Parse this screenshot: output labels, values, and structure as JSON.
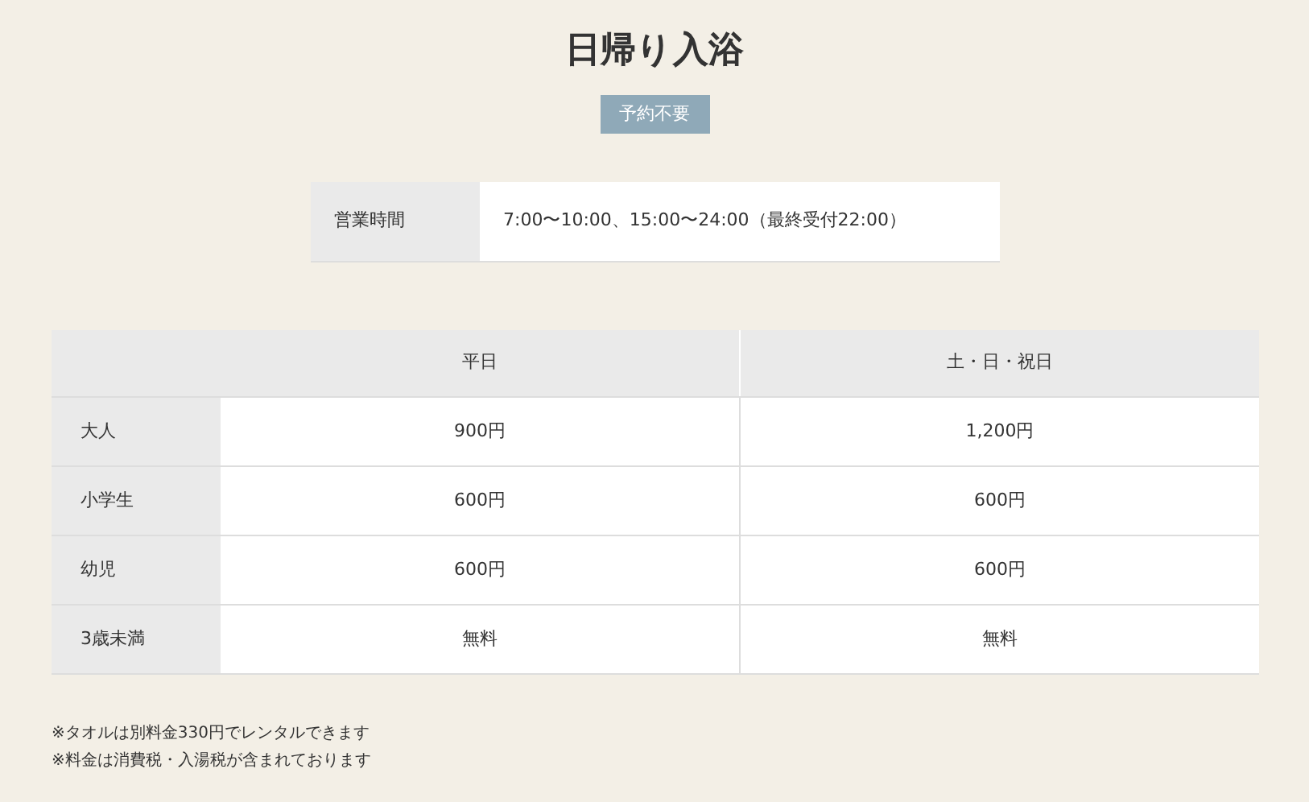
{
  "title": "日帰り入浴",
  "badge": "予約不要",
  "hours": {
    "label": "営業時間",
    "value": "7:00〜10:00、15:00〜24:00（最終受付22:00）"
  },
  "price_table": {
    "columns": [
      "平日",
      "土・日・祝日"
    ],
    "rows": [
      {
        "label": "大人",
        "cells": [
          "900円",
          "1,200円"
        ]
      },
      {
        "label": "小学生",
        "cells": [
          "600円",
          "600円"
        ]
      },
      {
        "label": "幼児",
        "cells": [
          "600円",
          "600円"
        ]
      },
      {
        "label": "3歳未満",
        "cells": [
          "無料",
          "無料"
        ]
      }
    ]
  },
  "notes": [
    "※タオルは別料金330円でレンタルできます",
    "※料金は消費税・入湯税が含まれております"
  ]
}
